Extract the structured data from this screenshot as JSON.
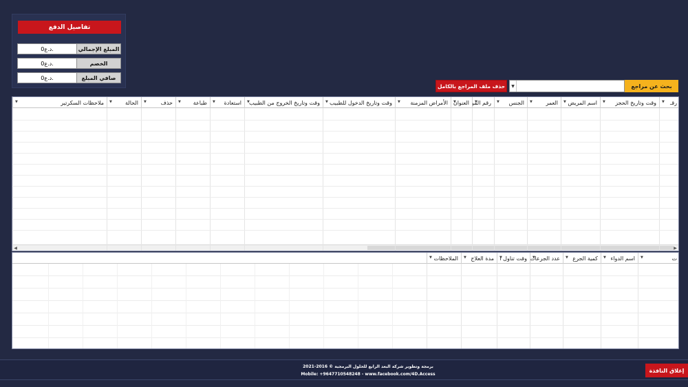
{
  "payment": {
    "title": "تفاصيل الدفع",
    "rows": [
      {
        "label": "المبلغ الإجمالي",
        "value": "0د.ع."
      },
      {
        "label": "الخصم",
        "value": "0د.ع."
      },
      {
        "label": "صافي المبلغ",
        "value": "0د.ع."
      }
    ]
  },
  "toolbar": {
    "delete_label": "حذف ملف المراجع بالكامل",
    "search_label": "بحث عن مراجع",
    "search_value": "",
    "combo_arrow": "▼"
  },
  "main_grid": {
    "columns": [
      "رقـ",
      "وقت وتاريخ الحجز",
      "اسم المريض",
      "العمر",
      "الجنس",
      "رقم الموبايل",
      "العنوان",
      "الأمراض المزمنة",
      "وقت وتاريخ الدخول للطبيب",
      "وقت وتاريخ الخروج من الطبيب",
      "استعادة",
      "طباعة",
      "حذف",
      "الحالة",
      "ملاحظات السكرتير"
    ]
  },
  "detail_grid": {
    "columns": [
      "ت",
      "اسم الدواء",
      "كمية الجرع",
      "عدد الجرعات",
      "وقت تناول ا",
      "مدة العلاج",
      "الملاحظات"
    ]
  },
  "footer": {
    "credit_line1": "برمجة وتطوير شركة البعد الرابع للحلول البرمجية © 2016-2021",
    "credit_line2": "Mobile: +9647710548248 - www.facebook.com/4D.Access",
    "close_label": "إغلاق النافذة"
  },
  "colors": {
    "background": "#232943",
    "accent_red": "#c8161c",
    "accent_yellow": "#f5b21d"
  }
}
